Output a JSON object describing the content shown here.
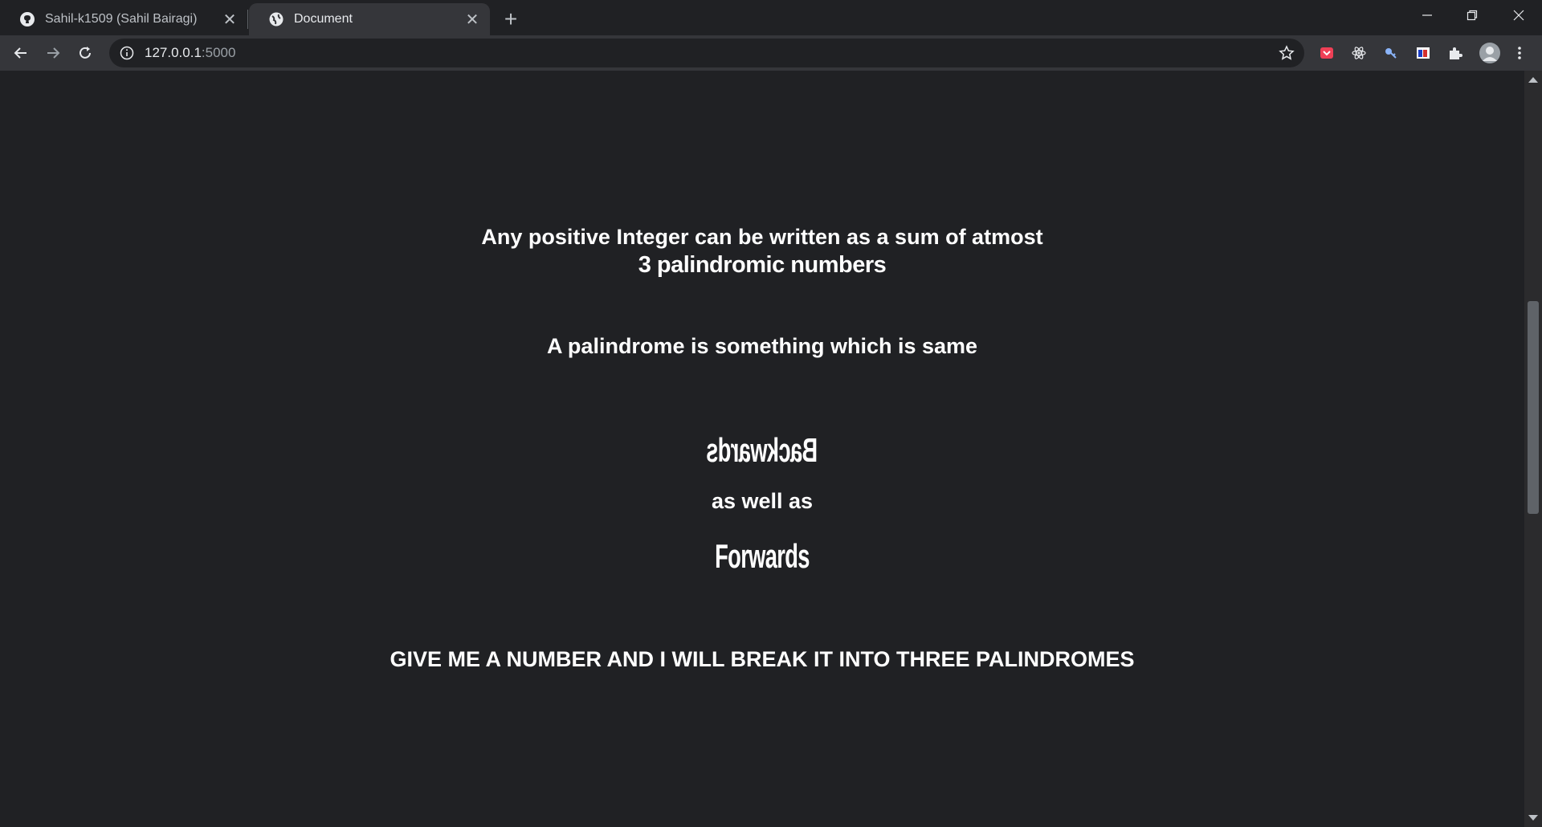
{
  "browser": {
    "tabs": [
      {
        "title": "Sahil-k1509 (Sahil Bairagi)",
        "icon": "github-icon",
        "active": false
      },
      {
        "title": "Document",
        "icon": "globe-icon",
        "active": true
      }
    ],
    "new_tab_label": "+",
    "address": {
      "host": "127.0.0.1",
      "port": ":5000"
    },
    "extensions": [
      "pocket-icon",
      "react-devtools-icon",
      "key-icon",
      "flag-icon",
      "puzzle-icon"
    ],
    "accent_color": "#35363a"
  },
  "page": {
    "line1": "Any positive Integer can be written as a sum of atmost",
    "line2": "3 palindromic numbers",
    "line3": "A palindrome is something which is same",
    "backwards_word": "Backwards",
    "as_well_as": "as well as",
    "forwards_word": "Forwards",
    "cta": "GIVE ME A NUMBER AND I WILL BREAK IT INTO THREE PALINDROMES",
    "background_color": "#202124",
    "text_color": "#ffffff"
  }
}
